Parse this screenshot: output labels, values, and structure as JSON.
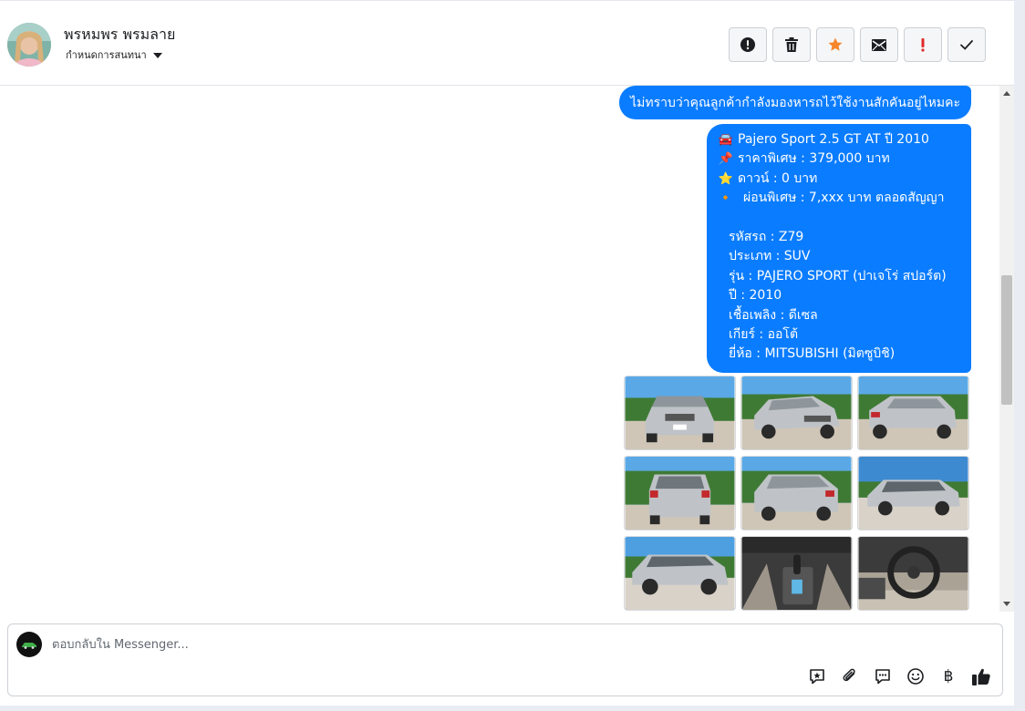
{
  "header": {
    "contact_name": "พรหมพร พรมลาย",
    "assign_label": "กำหนดการสนทนา",
    "actions": [
      {
        "name": "report-spam",
        "icon": "alert-circle-icon"
      },
      {
        "name": "delete",
        "icon": "trash-icon"
      },
      {
        "name": "star",
        "icon": "star-icon",
        "color": "#f5862a"
      },
      {
        "name": "mark-unread",
        "icon": "envelope-icon"
      },
      {
        "name": "important",
        "icon": "exclamation-icon",
        "color": "#e02a2a"
      },
      {
        "name": "mark-done",
        "icon": "check-icon"
      }
    ]
  },
  "messages": {
    "question": "ไม่ทราบว่าคุณลูกค้ากำลังมองหารถไว้ใช้งานสักคันอยู่ไหมคะ",
    "car_emoji": "🚘",
    "car_title": "Pajero Sport 2.5 GT AT ปี 2010",
    "pin_emoji": "📌",
    "price": "ราคาพิเศษ : 379,000 บาท",
    "star_emoji": "⭐",
    "down": "ดาวน์ : 0 บาท",
    "diamond_emoji": "🔸",
    "installment": "ผ่อนพิเศษ : 7,xxx บาท ตลอดสัญญา",
    "code": "รหัสรถ : Z79",
    "type": "ประเภท : SUV",
    "model": "รุ่น : PAJERO SPORT (ปาเจโร่ สปอร์ต)",
    "year": "ปี : 2010",
    "fuel": "เชื้อเพลิง : ดีเซล",
    "gear": "เกียร์ : ออโต้",
    "brand": "ยี่ห้อ : MITSUBISHI (มิตซูบิชิ)"
  },
  "photos": [
    {
      "view": "front",
      "color": "#bfc3c7"
    },
    {
      "view": "front-left",
      "color": "#bfc3c7"
    },
    {
      "view": "rear-right",
      "color": "#bfc3c7"
    },
    {
      "view": "rear",
      "color": "#bfc3c7"
    },
    {
      "view": "rear-left",
      "color": "#bfc3c7"
    },
    {
      "view": "side-left",
      "color": "#bfc3c7"
    },
    {
      "view": "side-left",
      "color": "#bfc3c7"
    },
    {
      "view": "gear-shifter",
      "color": "#3b3b3b"
    },
    {
      "view": "dashboard",
      "color": "#3b3b3b"
    }
  ],
  "composer": {
    "placeholder": "ตอบกลับใน Messenger...",
    "tools": [
      "saved-reply-icon",
      "attach-icon",
      "chat-bubble-icon",
      "emoji-icon",
      "baht-icon",
      "like-icon"
    ],
    "baht_symbol": "฿"
  },
  "colors": {
    "bubble": "#0a7cff",
    "star": "#f5862a",
    "important": "#e02a2a"
  }
}
